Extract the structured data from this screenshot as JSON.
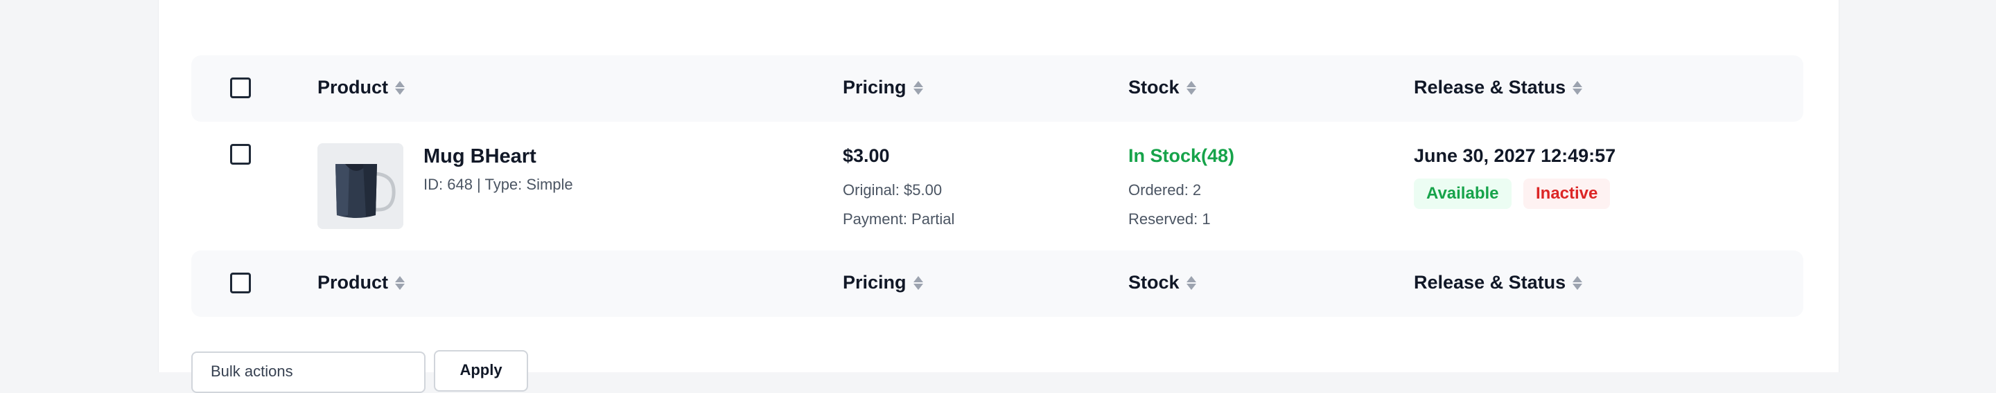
{
  "table": {
    "columns": [
      {
        "label": "Product"
      },
      {
        "label": "Pricing"
      },
      {
        "label": "Stock"
      },
      {
        "label": "Release & Status"
      }
    ],
    "rows": [
      {
        "product_name": "Mug BHeart",
        "product_meta": "ID: 648 | Type: Simple",
        "price": "$3.00",
        "original": "Original: $5.00",
        "payment": "Payment: Partial",
        "stock_status": "In Stock(48)",
        "ordered": "Ordered: 2",
        "reserved": "Reserved: 1",
        "release_date": "June 30, 2027 12:49:57",
        "badges": [
          "Available",
          "Inactive"
        ],
        "thumbnail_icon": "mug-icon"
      }
    ]
  },
  "bulk_actions": {
    "select_value": "Bulk actions",
    "apply_label": "Apply"
  },
  "colors": {
    "in_stock": "#16a34a",
    "available_bg": "#ecfdf3",
    "inactive_text": "#dc2626",
    "inactive_bg": "#fef2f2",
    "header_row_bg": "#f8f9fb"
  }
}
